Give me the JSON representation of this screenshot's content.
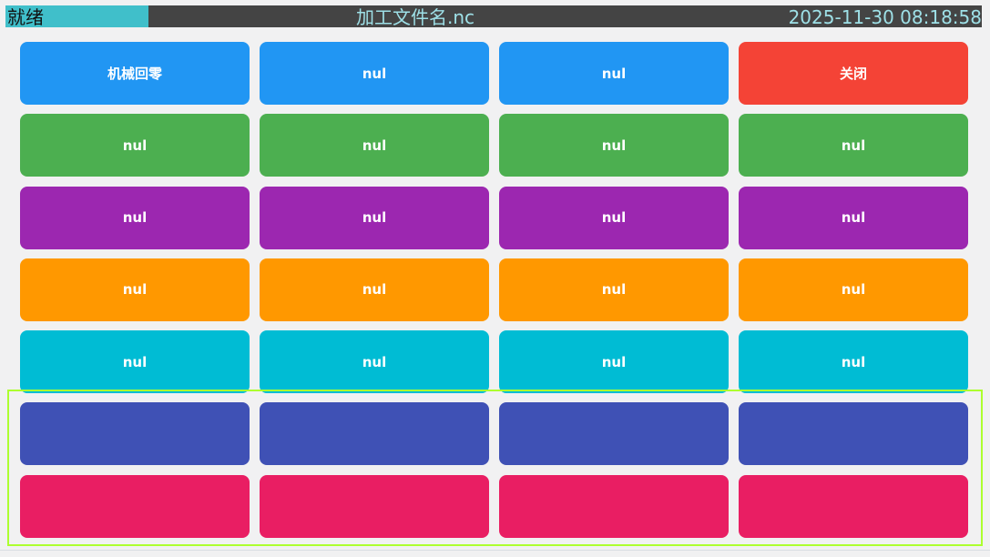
{
  "status_bar": {
    "status": "就绪",
    "file_name": "加工文件名.nc",
    "datetime": "2025-11-30 08:18:58",
    "colors": {
      "bar": "#444444",
      "status_bg": "#40bfca",
      "text": "#9ee0e7"
    }
  },
  "grid": {
    "rows": [
      {
        "color": "#2196f3",
        "labels": [
          "机械回零",
          "nul",
          "nul",
          ""
        ],
        "special": {
          "index": 3,
          "label": "关闭",
          "color": "#f44336"
        }
      },
      {
        "color": "#4caf50",
        "labels": [
          "nul",
          "nul",
          "nul",
          "nul"
        ]
      },
      {
        "color": "#9c27b0",
        "labels": [
          "nul",
          "nul",
          "nul",
          "nul"
        ]
      },
      {
        "color": "#ff9800",
        "labels": [
          "nul",
          "nul",
          "nul",
          "nul"
        ]
      },
      {
        "color": "#00bcd4",
        "labels": [
          "nul",
          "nul",
          "nul",
          "nul"
        ]
      },
      {
        "color": "#3f51b5",
        "labels": [
          "",
          "",
          "",
          ""
        ]
      },
      {
        "color": "#e91e63",
        "labels": [
          "",
          "",
          "",
          ""
        ]
      }
    ]
  },
  "highlight_color": "#adff2f"
}
